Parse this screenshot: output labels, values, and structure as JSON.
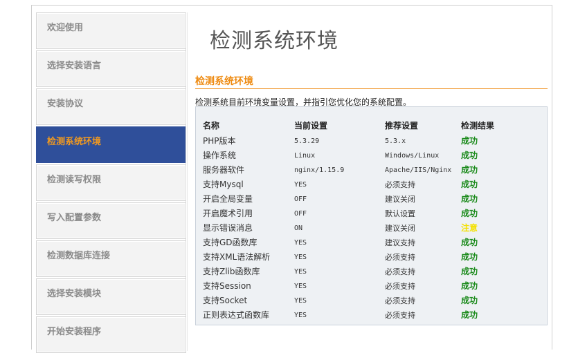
{
  "sidebar": {
    "steps": [
      {
        "label": "欢迎使用"
      },
      {
        "label": "选择安装语言"
      },
      {
        "label": "安装协议"
      },
      {
        "label": "检测系统环境"
      },
      {
        "label": "检测读写权限"
      },
      {
        "label": "写入配置参数"
      },
      {
        "label": "检测数据库连接"
      },
      {
        "label": "选择安装模块"
      },
      {
        "label": "开始安装程序"
      }
    ],
    "active_index": 3
  },
  "main": {
    "title": "检测系统环境",
    "section_title": "检测系统环境",
    "description": "检测系统目前环境变量设置，并指引您优化您的系统配置。",
    "table": {
      "headers": [
        "名称",
        "当前设置",
        "推荐设置",
        "检测结果"
      ],
      "rows": [
        {
          "name": "PHP版本",
          "current": "5.3.29",
          "recommended": "5.3.x",
          "result": "成功",
          "status": "ok"
        },
        {
          "name": "操作系统",
          "current": "Linux",
          "recommended": "Windows/Linux",
          "result": "成功",
          "status": "ok"
        },
        {
          "name": "服务器软件",
          "current": "nginx/1.15.9",
          "recommended": "Apache/IIS/Nginx",
          "result": "成功",
          "status": "ok"
        },
        {
          "name": "支持Mysql",
          "current": "YES",
          "recommended": "必须支持",
          "result": "成功",
          "status": "ok"
        },
        {
          "name": "开启全局变量",
          "current": "OFF",
          "recommended": "建议关闭",
          "result": "成功",
          "status": "ok"
        },
        {
          "name": "开启魔术引用",
          "current": "OFF",
          "recommended": "默认设置",
          "result": "成功",
          "status": "ok"
        },
        {
          "name": "显示错误消息",
          "current": "ON",
          "recommended": "建议关闭",
          "result": "注意",
          "status": "warn"
        },
        {
          "name": "支持GD函数库",
          "current": "YES",
          "recommended": "建议支持",
          "result": "成功",
          "status": "ok"
        },
        {
          "name": "支持XML语法解析",
          "current": "YES",
          "recommended": "必须支持",
          "result": "成功",
          "status": "ok"
        },
        {
          "name": "支持Zlib函数库",
          "current": "YES",
          "recommended": "必须支持",
          "result": "成功",
          "status": "ok"
        },
        {
          "name": "支持Session",
          "current": "YES",
          "recommended": "必须支持",
          "result": "成功",
          "status": "ok"
        },
        {
          "name": "支持Socket",
          "current": "YES",
          "recommended": "必须支持",
          "result": "成功",
          "status": "ok"
        },
        {
          "name": "正则表达式函数库",
          "current": "YES",
          "recommended": "必须支持",
          "result": "成功",
          "status": "ok"
        }
      ]
    }
  },
  "colors": {
    "accent": "#ee8a10",
    "active_step_bg": "#2f4f9a",
    "success": "#1a8a1a",
    "warning": "#f4e100"
  }
}
